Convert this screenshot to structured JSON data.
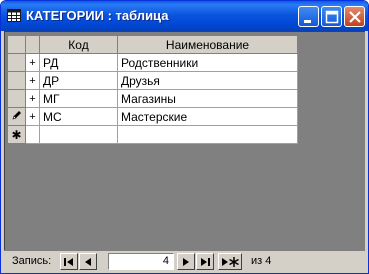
{
  "window": {
    "title": "КАТЕГОРИИ : таблица",
    "icon": "table-icon"
  },
  "table": {
    "columns": [
      "Код",
      "Наименование"
    ],
    "rows": [
      {
        "selector": "",
        "expand": "+",
        "code": "РД",
        "name": "Родственники"
      },
      {
        "selector": "",
        "expand": "+",
        "code": "ДР",
        "name": "Друзья"
      },
      {
        "selector": "",
        "expand": "+",
        "code": "МГ",
        "name": "Магазины"
      },
      {
        "selector": "pencil-icon",
        "expand": "+",
        "code": "МС",
        "name": "Мастерские"
      }
    ],
    "new_row_marker": "✱"
  },
  "navigation": {
    "label": "Запись:",
    "current_record": "4",
    "of_label": "из",
    "total": "4"
  },
  "colors": {
    "title_bar": "#0b56de",
    "client_bg": "#808080",
    "chrome": "#d4d0c8"
  }
}
